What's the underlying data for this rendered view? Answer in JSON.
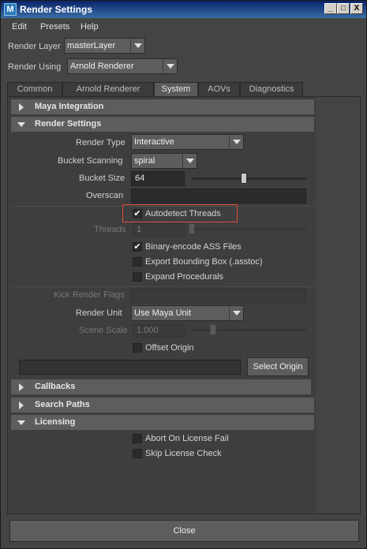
{
  "window": {
    "title": "Render Settings",
    "app_icon": "M"
  },
  "title_buttons": {
    "minimize": "_",
    "maximize": "□",
    "close": "X"
  },
  "menubar": {
    "items": [
      "Edit",
      "Presets",
      "Help"
    ]
  },
  "render_layer": {
    "label": "Render Layer",
    "value": "masterLayer"
  },
  "render_using": {
    "label": "Render Using",
    "value": "Arnold Renderer"
  },
  "tabs": [
    "Common",
    "Arnold Renderer",
    "System",
    "AOVs",
    "Diagnostics"
  ],
  "active_tab": "System",
  "sections": {
    "maya_integration": "Maya Integration",
    "render_settings": "Render Settings",
    "callbacks": "Callbacks",
    "search_paths": "Search Paths",
    "licensing": "Licensing"
  },
  "render_settings": {
    "render_type": {
      "label": "Render Type",
      "value": "Interactive"
    },
    "bucket_scanning": {
      "label": "Bucket Scanning",
      "value": "spiral"
    },
    "bucket_size": {
      "label": "Bucket Size",
      "value": "64",
      "slider_fraction": 0.46
    },
    "overscan": {
      "label": "Overscan",
      "value": ""
    },
    "autodetect_threads": {
      "label": "Autodetect Threads",
      "checked": true
    },
    "threads": {
      "label": "Threads",
      "value": "1"
    },
    "binary_encode": {
      "label": "Binary-encode ASS Files",
      "checked": true
    },
    "export_bbox": {
      "label": "Export Bounding Box (.asstoc)",
      "checked": false
    },
    "expand_procedurals": {
      "label": "Expand Procedurals",
      "checked": false
    },
    "kick_render_flags": {
      "label": "Kick Render Flags",
      "value": ""
    },
    "render_unit": {
      "label": "Render Unit",
      "value": "Use Maya Unit"
    },
    "scene_scale": {
      "label": "Scene Scale",
      "value": "1.000"
    },
    "offset_origin": {
      "label": "Offset Origin",
      "checked": false
    },
    "select_origin_button": "Select Origin"
  },
  "licensing": {
    "abort_on_license_fail": {
      "label": "Abort On License Fail",
      "checked": false
    },
    "skip_license_check": {
      "label": "Skip License Check",
      "checked": false
    }
  },
  "close_button": "Close",
  "colors": {
    "highlight": "#e04a3a",
    "titlebar": "#0a246a"
  }
}
